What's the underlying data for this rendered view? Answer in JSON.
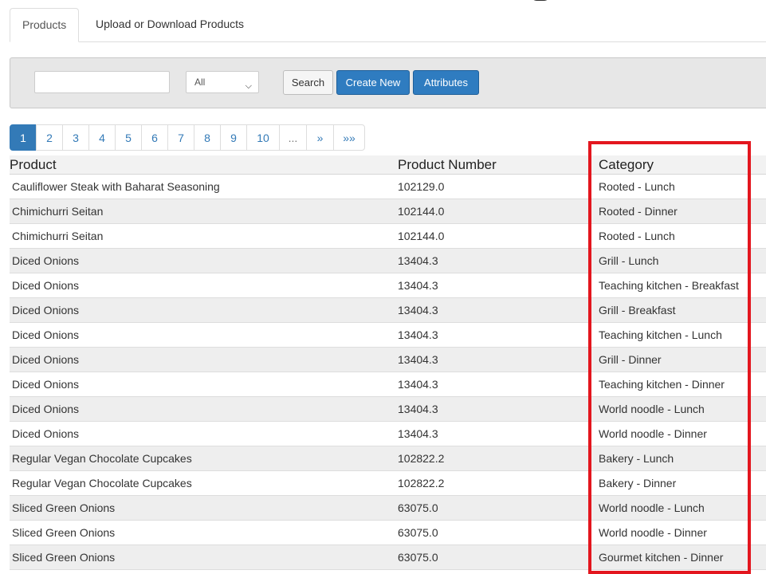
{
  "tabs": [
    {
      "label": "Products",
      "active": true
    },
    {
      "label": "Upload or Download Products",
      "active": false
    }
  ],
  "toolbar": {
    "search_value": "",
    "filter_selected": "All",
    "search_label": "Search",
    "create_label": "Create New",
    "attributes_label": "Attributes"
  },
  "pagination": [
    "1",
    "2",
    "3",
    "4",
    "5",
    "6",
    "7",
    "8",
    "9",
    "10",
    "...",
    "»",
    "»»"
  ],
  "table": {
    "headers": [
      "Product",
      "Product Number",
      "Category"
    ],
    "rows": [
      [
        "Cauliflower Steak with Baharat Seasoning",
        "102129.0",
        "Rooted - Lunch"
      ],
      [
        "Chimichurri Seitan",
        "102144.0",
        "Rooted - Dinner"
      ],
      [
        "Chimichurri Seitan",
        "102144.0",
        "Rooted - Lunch"
      ],
      [
        "Diced Onions",
        "13404.3",
        "Grill - Lunch"
      ],
      [
        "Diced Onions",
        "13404.3",
        "Teaching kitchen - Breakfast"
      ],
      [
        "Diced Onions",
        "13404.3",
        "Grill - Breakfast"
      ],
      [
        "Diced Onions",
        "13404.3",
        "Teaching kitchen - Lunch"
      ],
      [
        "Diced Onions",
        "13404.3",
        "Grill - Dinner"
      ],
      [
        "Diced Onions",
        "13404.3",
        "Teaching kitchen - Dinner"
      ],
      [
        "Diced Onions",
        "13404.3",
        "World noodle - Lunch"
      ],
      [
        "Diced Onions",
        "13404.3",
        "World noodle - Dinner"
      ],
      [
        "Regular Vegan Chocolate Cupcakes",
        "102822.2",
        "Bakery - Lunch"
      ],
      [
        "Regular Vegan Chocolate Cupcakes",
        "102822.2",
        "Bakery - Dinner"
      ],
      [
        "Sliced Green Onions",
        "63075.0",
        "World noodle - Lunch"
      ],
      [
        "Sliced Green Onions",
        "63075.0",
        "World noodle - Dinner"
      ],
      [
        "Sliced Green Onions",
        "63075.0",
        "Gourmet kitchen - Dinner"
      ]
    ]
  },
  "colors": {
    "primary": "#2f7cc0",
    "link": "#337ab7",
    "highlight": "#e3161e"
  }
}
